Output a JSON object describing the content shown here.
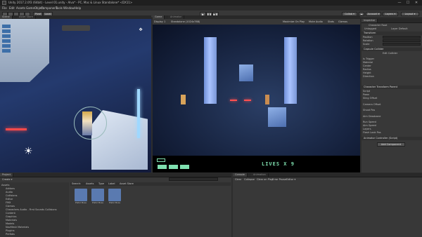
{
  "window": {
    "title": "Unity 2017.2.0f3 (64bit) - Level 01.unity - Alva* - PC, Mac & Linux Standalone* <DX11>",
    "controls": [
      "—",
      "☐",
      "✕"
    ]
  },
  "menu": [
    "File",
    "Edit",
    "Assets",
    "GameObject",
    "Component",
    "Tools",
    "Window",
    "Help"
  ],
  "toolbar": {
    "pivot": "Pivot",
    "local": "Local",
    "collab": "Collab ▾",
    "account": "Account ▾",
    "layers": "Layers ▾",
    "layout": "Layout ▾"
  },
  "scene_tabs": {
    "scene": "Scene",
    "asset_store": "Asset Store",
    "shaded": "Shaded",
    "mode2d": "2D"
  },
  "game_tabs": {
    "game": "Game",
    "animator": "Animator",
    "display": "Display 1",
    "resolution": "Standalone (1024x768)",
    "maximize": "Maximize On Play",
    "mute": "Mute Audio",
    "stats": "Stats",
    "gizmos": "Gizmos"
  },
  "hud": {
    "lives": "LIVES X 9",
    "health_cells": 3
  },
  "inspector": {
    "tab": "Inspector",
    "object_name": "Character Root",
    "tag": "Untagged",
    "layer": "Layer Default",
    "transform": "Transform",
    "rows": [
      "Position",
      "Rotation",
      "Scale"
    ],
    "capsule": "Capsule Collider",
    "capsule_rows": [
      "Edit Collider",
      "Is Trigger",
      "Material",
      "Center",
      "Radius",
      "Height",
      "Direction"
    ],
    "character": "Character Transform Parent",
    "character_rows": [
      "Script",
      "Pawn",
      "Sling Offset",
      "Camera Offset",
      "Shoot Pos",
      "Aim Deadzone",
      "Run Speed",
      "Aim Speed",
      "Layers",
      "Flash Look Pos"
    ],
    "animator": "Animator Controller (Script)",
    "add_component": "Add Component"
  },
  "project": {
    "tabs": [
      "Project",
      "Create ▾"
    ],
    "search": "",
    "breadcrumb": "Collisions Audio",
    "filters": [
      "Search:",
      "Assets",
      "Type",
      "Label",
      "Asset Store"
    ],
    "tree": [
      "Assets",
      "Addons",
      "Audio",
      "Collisions",
      "Editor",
      "FMX",
      "Gizmos",
      "Characters Audio - First Sounds Collisions",
      "Content",
      "Graphics",
      "Materials",
      "Models",
      "NavMesh Materials",
      "Plugins",
      "Prefabs",
      "Physics"
    ],
    "assets": [
      "Pistol Boss",
      "Pistol Boss",
      "Pistol Boss"
    ]
  },
  "console": {
    "tabs": [
      "Console",
      "Animation"
    ],
    "buttons": [
      "Clear",
      "Collapse",
      "Clear on Play",
      "Error Pause",
      "Editor ▾"
    ]
  }
}
